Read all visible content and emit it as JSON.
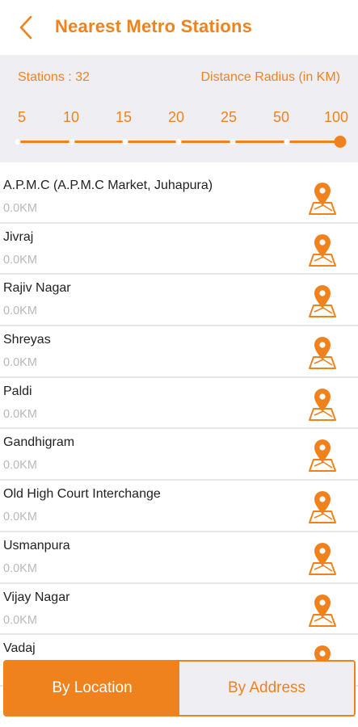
{
  "header": {
    "title": "Nearest Metro Stations"
  },
  "filter": {
    "stations_label": "Stations : 32",
    "radius_label": "Distance Radius (in KM)",
    "ticks": [
      "5",
      "10",
      "15",
      "20",
      "25",
      "50",
      "100"
    ],
    "selected_radius": "100"
  },
  "stations": [
    {
      "name": "A.P.M.C (A.P.M.C Market, Juhapura)",
      "distance": "0.0KM"
    },
    {
      "name": "Jivraj",
      "distance": "0.0KM"
    },
    {
      "name": "Rajiv Nagar",
      "distance": "0.0KM"
    },
    {
      "name": "Shreyas",
      "distance": "0.0KM"
    },
    {
      "name": "Paldi",
      "distance": "0.0KM"
    },
    {
      "name": "Gandhigram",
      "distance": "0.0KM"
    },
    {
      "name": "Old High Court Interchange",
      "distance": "0.0KM"
    },
    {
      "name": "Usmanpura",
      "distance": "0.0KM"
    },
    {
      "name": "Vijay Nagar",
      "distance": "0.0KM"
    },
    {
      "name": "Vadaj",
      "distance": ""
    }
  ],
  "tabs": {
    "by_location": "By Location",
    "by_address": "By Address",
    "active": "by_location"
  },
  "colors": {
    "accent": "#f0821e",
    "panel_bg": "#eeeef3",
    "distance_text": "#b8b8b8"
  },
  "icons": {
    "back": "chevron-left-icon",
    "map": "map-pin-icon"
  }
}
